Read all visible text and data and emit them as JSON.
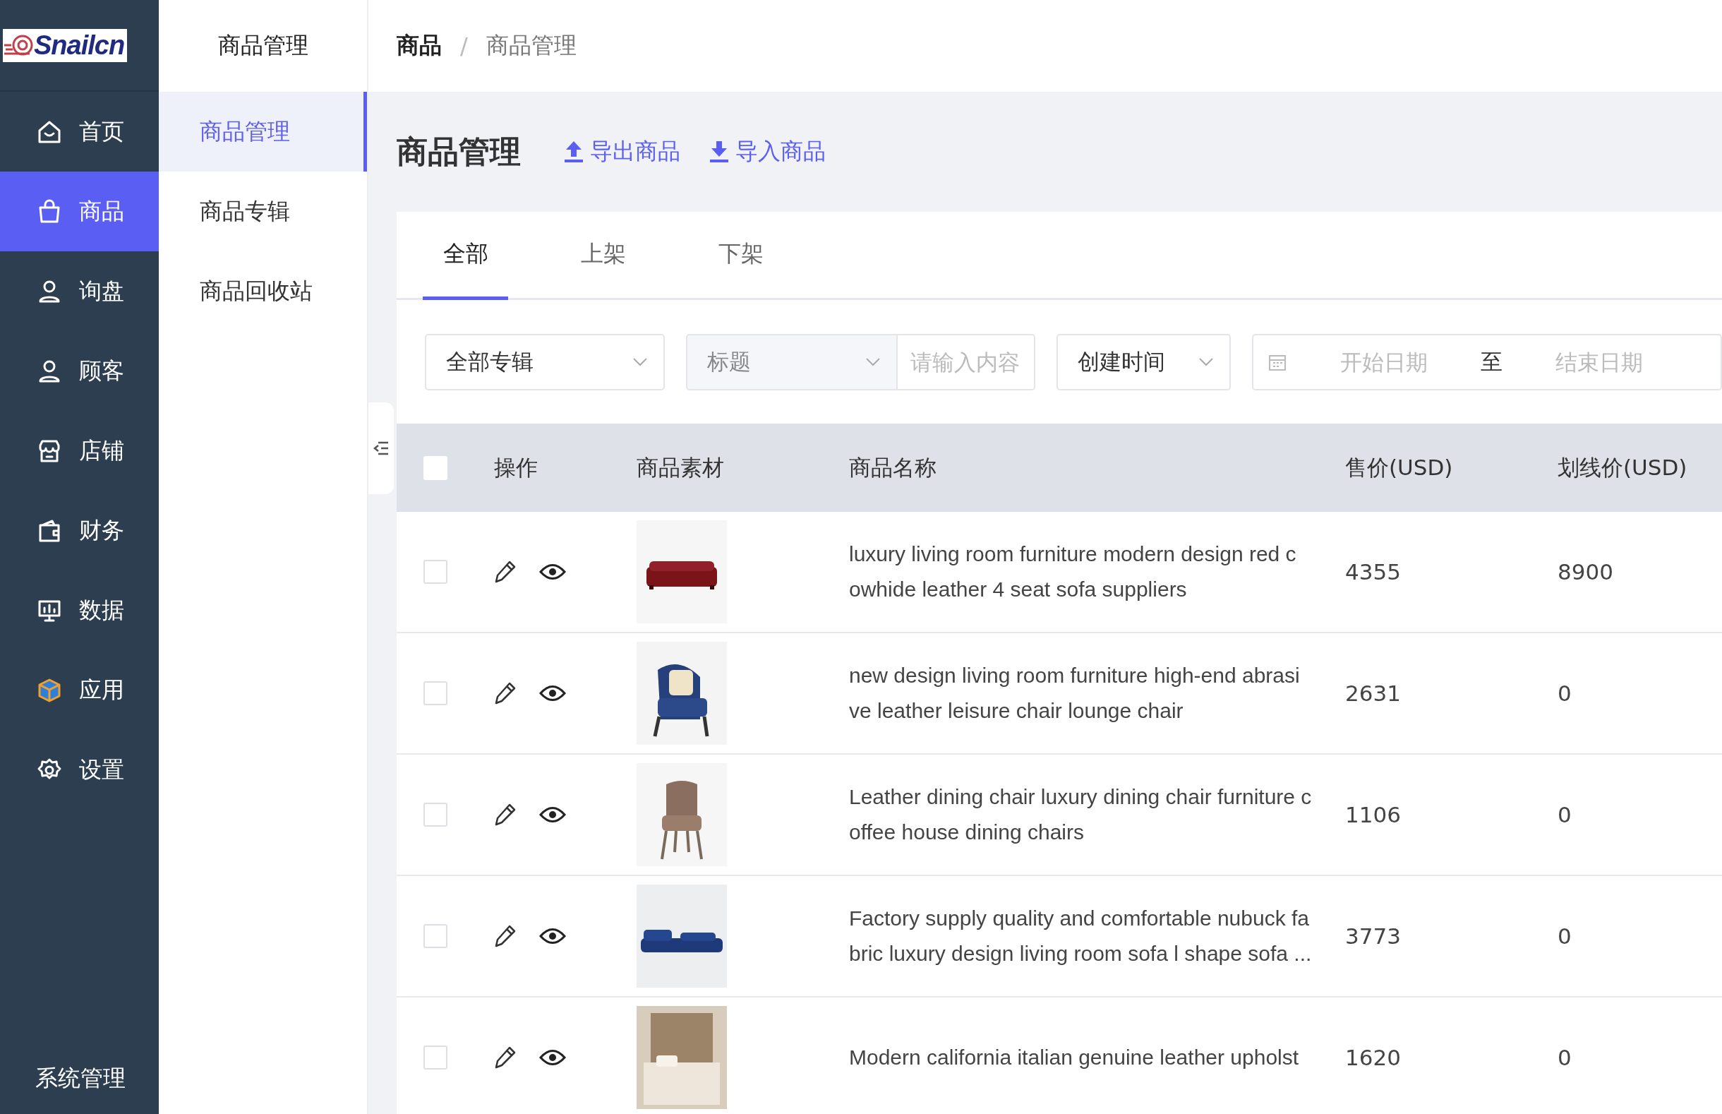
{
  "logo": "Snailcn",
  "nav": [
    {
      "label": "首页",
      "selected": false
    },
    {
      "label": "商品",
      "selected": true
    },
    {
      "label": "询盘",
      "selected": false
    },
    {
      "label": "顾客",
      "selected": false
    },
    {
      "label": "店铺",
      "selected": false
    },
    {
      "label": "财务",
      "selected": false
    },
    {
      "label": "数据",
      "selected": false
    },
    {
      "label": "应用",
      "selected": false
    },
    {
      "label": "设置",
      "selected": false
    }
  ],
  "system_link": "系统管理",
  "submenu": {
    "title": "商品管理",
    "items": [
      {
        "label": "商品管理",
        "selected": true
      },
      {
        "label": "商品专辑",
        "selected": false
      },
      {
        "label": "商品回收站",
        "selected": false
      }
    ]
  },
  "breadcrumb": [
    "商品",
    "商品管理"
  ],
  "breadcrumb_separator": "/",
  "page_title": "商品管理",
  "actions": [
    {
      "label": "导出商品"
    },
    {
      "label": "导入商品"
    }
  ],
  "tabs": [
    {
      "label": "全部",
      "selected": true
    },
    {
      "label": "上架",
      "selected": false
    },
    {
      "label": "下架",
      "selected": false
    }
  ],
  "filters": {
    "album": "全部专辑",
    "field": "标题",
    "keyword_placeholder": "请输入内容",
    "time_field": "创建时间",
    "start_placeholder": "开始日期",
    "range_separator": "至",
    "end_placeholder": "结束日期"
  },
  "table": {
    "all_checked": false,
    "columns": [
      "操作",
      "商品素材",
      "商品名称",
      "售价(USD)",
      "划线价(USD)"
    ],
    "rows": [
      {
        "checked": false,
        "name": "luxury living room furniture modern design red c\nowhide leather 4 seat sofa suppliers",
        "price": "4355",
        "list_price": "8900"
      },
      {
        "checked": false,
        "name": "new design living room furniture high-end abrasi\nve leather leisure chair lounge chair",
        "price": "2631",
        "list_price": "0"
      },
      {
        "checked": false,
        "name": "Leather dining chair luxury dining chair furniture c\noffee house dining chairs",
        "price": "1106",
        "list_price": "0"
      },
      {
        "checked": false,
        "name": "Factory supply quality and comfortable nubuck fa\nbric luxury design living room sofa l shape sofa ...",
        "price": "3773",
        "list_price": "0"
      },
      {
        "checked": false,
        "name": "Modern california italian genuine leather upholst",
        "price": "1620",
        "list_price": "0"
      }
    ]
  }
}
